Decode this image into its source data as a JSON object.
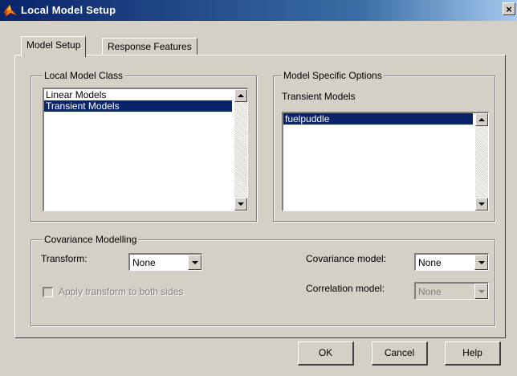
{
  "window": {
    "title": "Local Model Setup",
    "close_glyph": "×"
  },
  "tabs": [
    {
      "label": "Model Setup",
      "active": true
    },
    {
      "label": "Response Features",
      "active": false
    }
  ],
  "local_model_class": {
    "title": "Local Model Class",
    "items": [
      {
        "label": "Linear Models",
        "selected": false
      },
      {
        "label": "Transient Models",
        "selected": true
      }
    ]
  },
  "model_specific_options": {
    "title": "Model Specific Options",
    "subtitle": "Transient Models",
    "items": [
      {
        "label": "fuelpuddle",
        "selected": true
      }
    ]
  },
  "covariance": {
    "title": "Covariance Modelling",
    "transform_label": "Transform:",
    "transform_value": "None",
    "apply_label": "Apply transform to both sides",
    "apply_checked": false,
    "cov_model_label": "Covariance model:",
    "cov_model_value": "None",
    "corr_model_label": "Correlation model:",
    "corr_model_value": "None"
  },
  "buttons": {
    "ok": "OK",
    "cancel": "Cancel",
    "help": "Help"
  },
  "colors": {
    "selection": "#0a246a",
    "title_bar": "#0a246a",
    "face": "#d4d0c8"
  }
}
